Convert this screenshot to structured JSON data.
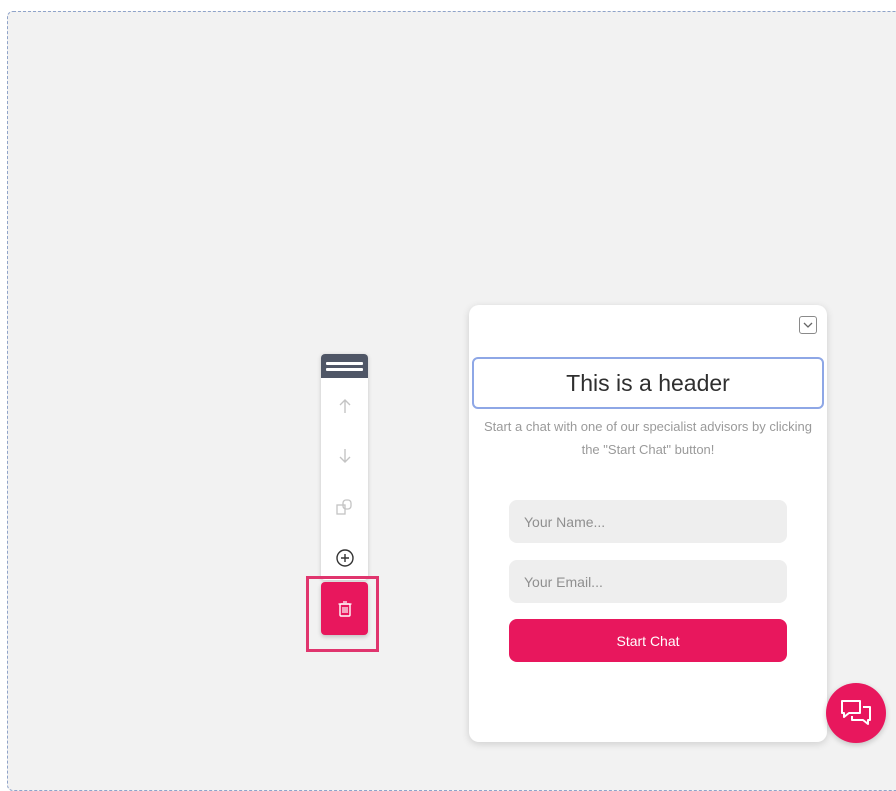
{
  "toolbar": {
    "icons": [
      "drag-handle-icon",
      "arrow-up-icon",
      "arrow-down-icon",
      "duplicate-icon",
      "add-circle-icon",
      "trash-icon"
    ]
  },
  "widget": {
    "header": "This is a header",
    "intro": "Start a chat with one of our specialist advisors by clicking the \"Start Chat\" button!",
    "name_placeholder": "Your Name...",
    "email_placeholder": "Your Email...",
    "start_label": "Start Chat"
  },
  "colors": {
    "accent": "#e8175d",
    "toolbar_handle": "#4f5666",
    "header_border": "#8ea7e6"
  }
}
